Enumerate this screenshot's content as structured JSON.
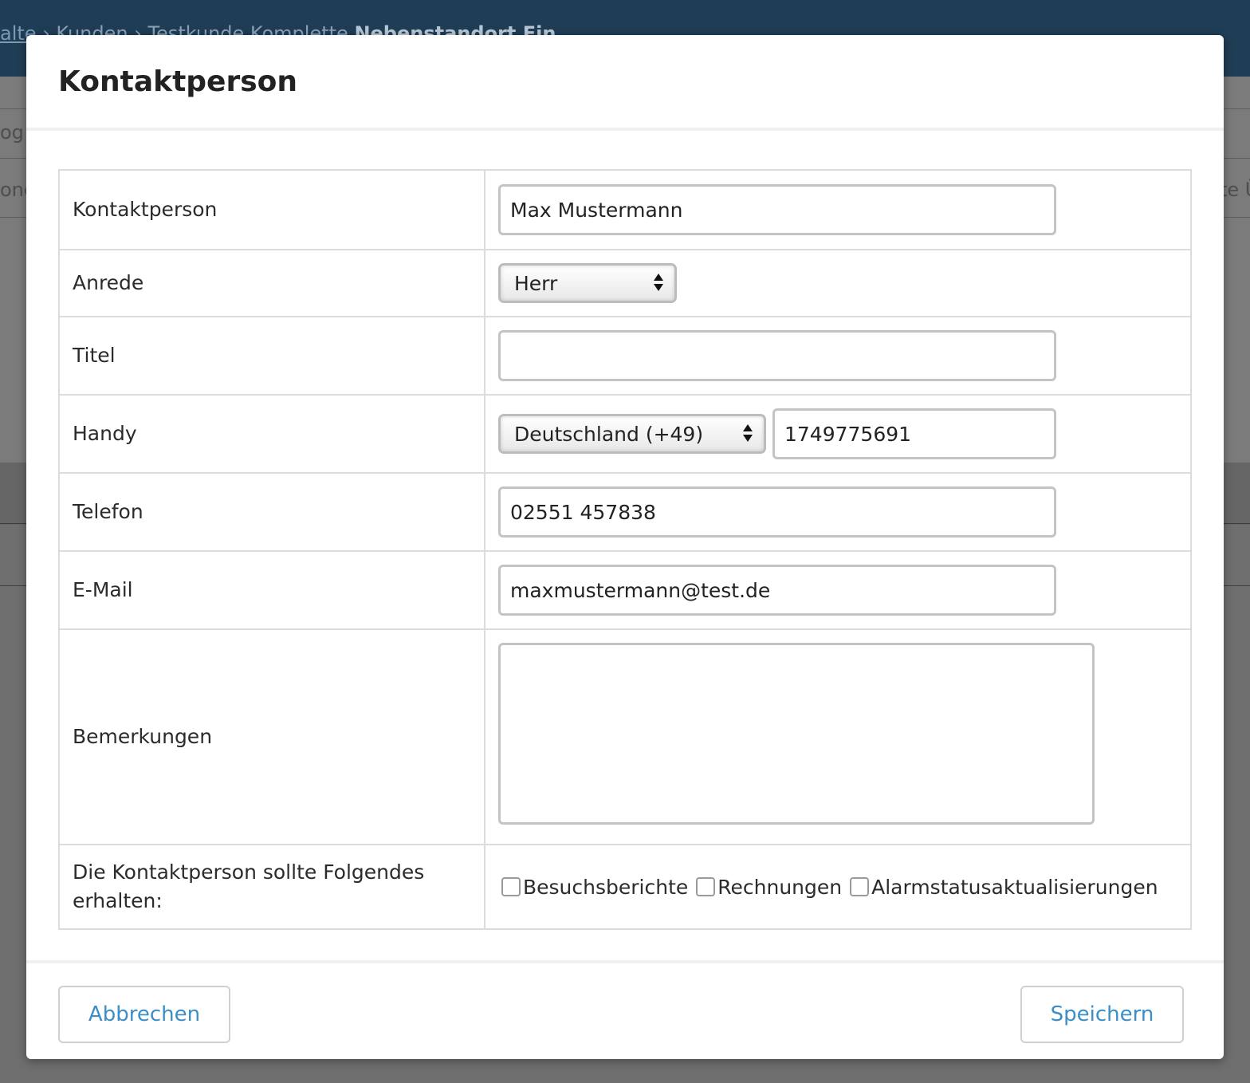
{
  "background": {
    "breadcrumb": {
      "item1": "alte",
      "item2": "› Kunden › Testkunde Komplette",
      "item3": "Nebenstandort Ein"
    },
    "fragments": [
      "og",
      "one",
      "te Ü"
    ]
  },
  "modal": {
    "title": "Kontaktperson",
    "fields": {
      "contact": {
        "label": "Kontaktperson",
        "value": "Max Mustermann"
      },
      "salutation": {
        "label": "Anrede",
        "value": "Herr"
      },
      "title": {
        "label": "Titel",
        "value": ""
      },
      "mobile": {
        "label": "Handy",
        "country": "Deutschland (+49)",
        "number": "1749775691"
      },
      "phone": {
        "label": "Telefon",
        "value": "02551 457838"
      },
      "email": {
        "label": "E-Mail",
        "value": "maxmustermann@test.de"
      },
      "remarks": {
        "label": "Bemerkungen",
        "value": ""
      },
      "receive": {
        "label": "Die Kontaktperson sollte Folgendes erhalten:",
        "options": [
          "Besuchsberichte",
          "Rechnungen",
          "Alarmstatusaktualisierungen"
        ]
      }
    },
    "footer": {
      "cancel_label": "Abbrechen",
      "save_label": "Speichern"
    }
  },
  "colors": {
    "accent": "#3b8fc6",
    "header_bg": "#1f3d55"
  }
}
